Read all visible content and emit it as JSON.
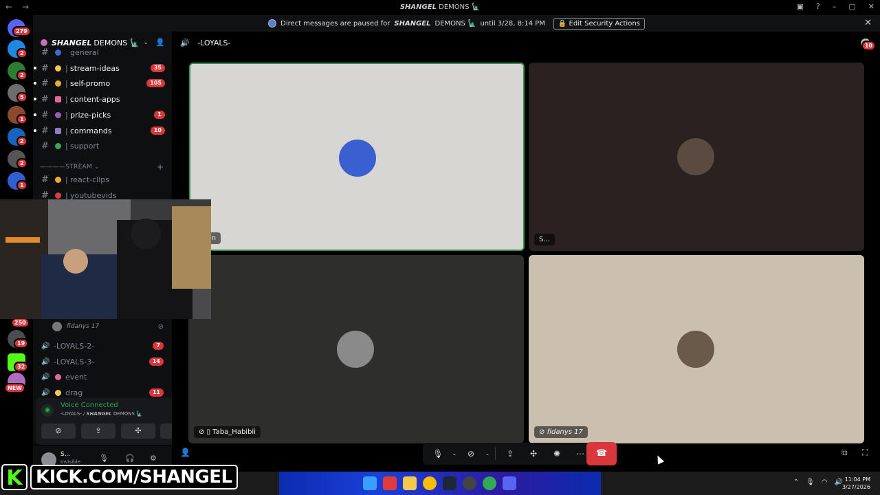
{
  "titlebar": {
    "title_prefix": "SHANGEL",
    "title_rest": "DEMONS 🗽",
    "nav_back": "←",
    "nav_forward": "→"
  },
  "notice": {
    "text_before": "Direct messages are paused for",
    "server_bold": "SHANGEL",
    "server_rest": "DEMONS 🗽",
    "text_after": "until 3/28, 8:14 PM",
    "button": "🔒 Edit Security Actions",
    "close": "✕"
  },
  "rail_badges": [
    "279",
    "2",
    "2",
    "5",
    "1",
    "2",
    "2",
    "1",
    "250",
    "19",
    "32",
    "NEW"
  ],
  "server_header": {
    "bold": "SHANGEL",
    "rest": "DEMONS 🗽",
    "chevron": "⌄"
  },
  "text_channels": [
    {
      "name": "general",
      "count": ""
    },
    {
      "name": "stream-ideas",
      "count": "35"
    },
    {
      "name": "self-promo",
      "count": "105"
    },
    {
      "name": "content-apps",
      "count": ""
    },
    {
      "name": "prize-picks",
      "count": "1"
    },
    {
      "name": "commands",
      "count": "10"
    },
    {
      "name": "support",
      "count": ""
    }
  ],
  "stream_category": "————STREAM ⌄",
  "stream_channels": [
    {
      "name": "react-clips"
    },
    {
      "name": "youtubevids"
    }
  ],
  "member_in_voice": "fidanys 17",
  "voice_channels": [
    {
      "name": "-LOYALS-2-",
      "count": "7"
    },
    {
      "name": "-LOYALS-3-",
      "count": "14"
    },
    {
      "name": "event",
      "count": ""
    },
    {
      "name": "drag",
      "count": "11"
    }
  ],
  "voice_panel": {
    "status": "Voice Connected",
    "sub_channel": "-LOYALS- /",
    "sub_bold": "SHANGEL",
    "sub_rest": "DEMONS 🗽"
  },
  "user": {
    "name": "S...",
    "status": "Invisible"
  },
  "main": {
    "channel_title": "-LOYALS-",
    "inbox_badge": "10"
  },
  "tiles": [
    {
      "label": "...an",
      "bg": "#d8d6d3",
      "av": "#3a5fd0"
    },
    {
      "label": "S...",
      "bg": "#2a2220",
      "av": "#5a4a40"
    },
    {
      "label": "Taba_Habibii",
      "bg": "#2e2f2c",
      "av": "#8a8a8a"
    },
    {
      "label": "fidanys 17",
      "bg": "#cbbfb0",
      "av": "#6a5a4a"
    }
  ],
  "clock": {
    "time": "11:04 PM",
    "date": "3/27/2026"
  },
  "kick": {
    "logo": "K",
    "text": "KICK.COM/SHANGEL"
  },
  "colors": {
    "accent_red": "#da373c",
    "voice_green": "#23a55a",
    "kick_green": "#53fc18"
  }
}
